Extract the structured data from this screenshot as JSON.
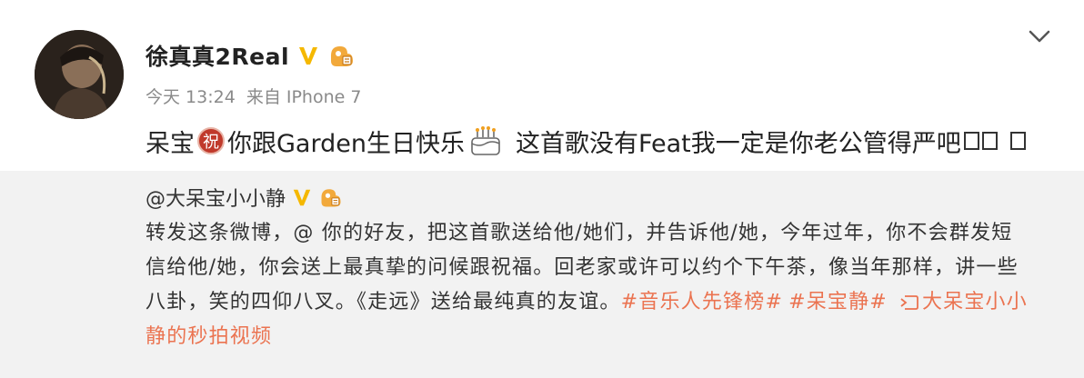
{
  "post": {
    "author": "徐真真2Real",
    "time": "今天 13:24",
    "source_prefix": "来自",
    "source": "IPhone 7",
    "text_1": "呆宝",
    "emoji_zhu": "祝",
    "text_2": "你跟Garden生日快乐",
    "text_3": "这首歌没有Feat我一定是你老公管得严吧"
  },
  "repost": {
    "author": "@大呆宝小小静",
    "line_1": "转发这条微博，@ 你的好友，把这首歌送给他/她们，并告诉他/她，今年过年，你不会群发短",
    "line_2": "信给他/她，你会送上最真挚的问候跟祝福。回老家或许可以约个下午茶，像当年那样，讲一些",
    "line_3_prefix": "八卦，笑的四仰八叉。《走远》送给最纯真的友谊。",
    "hashtag_1": "#音乐人先锋榜#",
    "hashtag_2": "#呆宝静#",
    "video_link_1": "大呆宝小小",
    "video_link_2": "静的秒拍视频"
  },
  "icons": {
    "verified": "verified-v-icon",
    "fan_badge": "fan-badge-icon",
    "expand": "chevron-down-icon",
    "video": "video-icon",
    "cake": "cake-emoji-icon"
  },
  "colors": {
    "link": "#eb7350",
    "verified": "#f5b800",
    "repost_bg": "#f2f2f2",
    "meta": "#8a8a8a"
  }
}
